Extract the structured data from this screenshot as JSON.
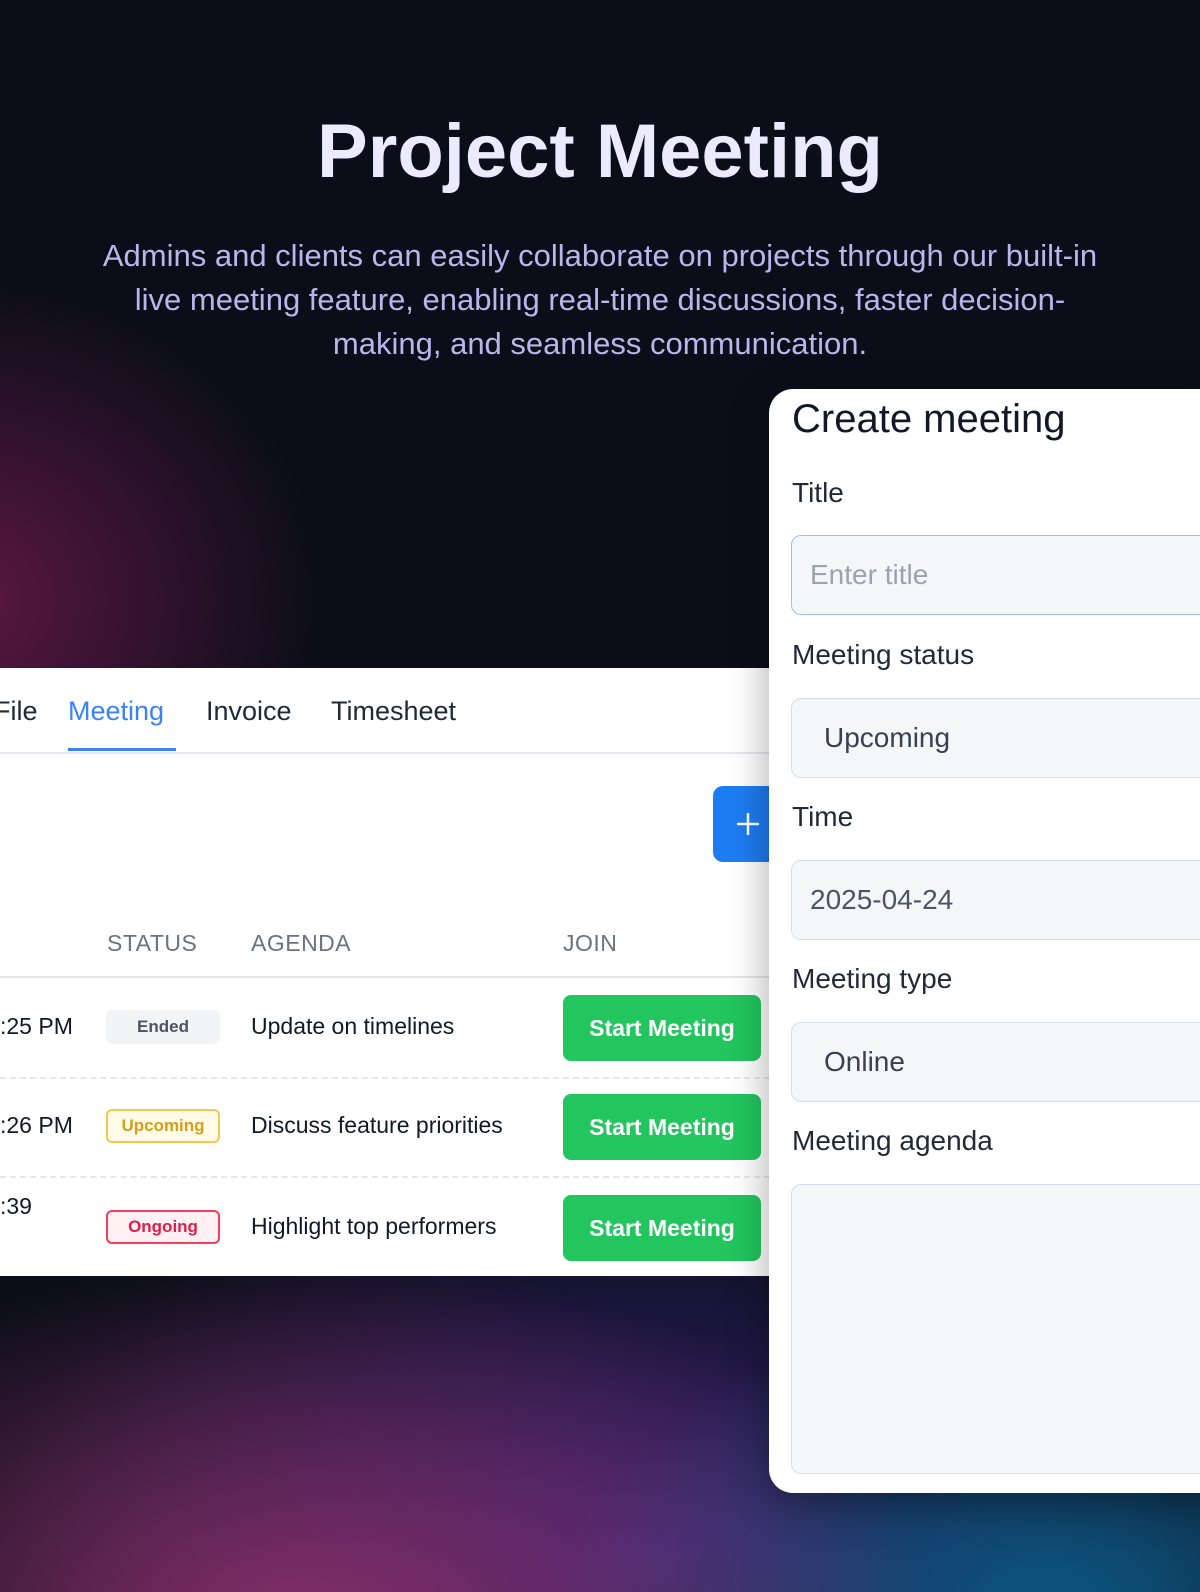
{
  "hero": {
    "title": "Project Meeting",
    "description": "Admins and clients can easily collaborate on projects through our built-in live meeting feature, enabling real-time discussions, faster decision-making, and seamless communication."
  },
  "tabs": [
    {
      "label": "File"
    },
    {
      "label": "Meeting",
      "active": true
    },
    {
      "label": "Invoice"
    },
    {
      "label": "Timesheet"
    }
  ],
  "add_button_icon": "plus-icon",
  "table": {
    "headers": [
      "STATUS",
      "AGENDA",
      "JOIN"
    ],
    "rows": [
      {
        "time": ":25 PM",
        "status": "Ended",
        "agenda": "Update on timelines",
        "join": "Start Meeting"
      },
      {
        "time": ":26 PM",
        "status": "Upcoming",
        "agenda": "Discuss feature priorities",
        "join": "Start Meeting"
      },
      {
        "time": ":39",
        "status": "Ongoing",
        "agenda": "Highlight top performers",
        "join": "Start Meeting"
      }
    ]
  },
  "create_meeting": {
    "title": "Create meeting",
    "title_label": "Title",
    "title_placeholder": "Enter title",
    "status_label": "Meeting status",
    "status_value": "Upcoming",
    "time_label": "Time",
    "time_value": "2025-04-24",
    "type_label": "Meeting type",
    "type_value": "Online",
    "agenda_label": "Meeting agenda",
    "agenda_value": ""
  },
  "colors": {
    "accent": "#3b82f6",
    "start_button": "#22c55e",
    "add_button": "#1e7cf2"
  }
}
